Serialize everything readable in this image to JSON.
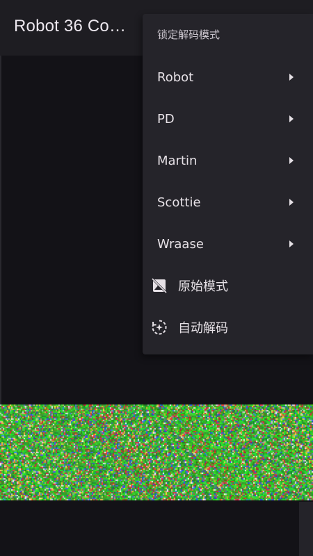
{
  "app": {
    "title": "Robot 36 Co…"
  },
  "menu": {
    "header": "锁定解码模式",
    "items": [
      {
        "label": "Robot",
        "submenu": true
      },
      {
        "label": "PD",
        "submenu": true
      },
      {
        "label": "Martin",
        "submenu": true
      },
      {
        "label": "Scottie",
        "submenu": true
      },
      {
        "label": "Wraase",
        "submenu": true
      },
      {
        "label": "原始模式",
        "icon": "raw-image-icon"
      },
      {
        "label": "自动解码",
        "icon": "auto-decode-icon"
      }
    ]
  },
  "colors": {
    "background": "#131217",
    "appbar": "#1e1d22",
    "menu": "#25242a",
    "text": "#e6e1e6"
  }
}
